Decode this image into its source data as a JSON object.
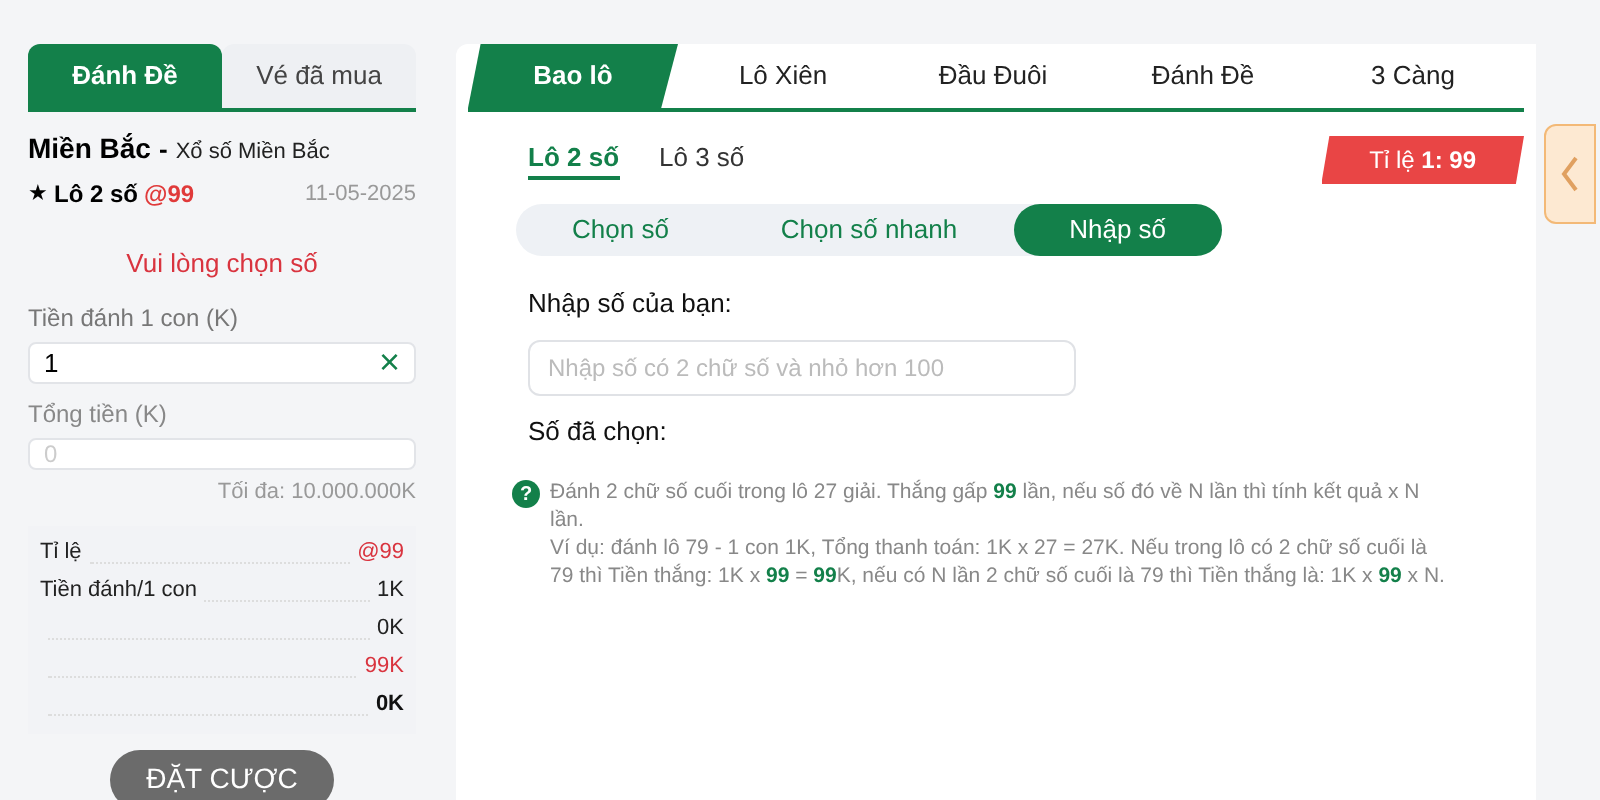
{
  "left_tabs": [
    {
      "label": "Đánh Đề",
      "selected": true
    },
    {
      "label": "Vé đã mua",
      "selected": false
    }
  ],
  "region": {
    "title": "Miền Bắc",
    "separator": "-",
    "subtitle": "Xổ số Miền Bắc"
  },
  "bet_type": {
    "star": "★",
    "name": "Lô 2 số",
    "odds": "@99",
    "date": "11-05-2025"
  },
  "warning": "Vui lòng chọn số",
  "stake_field": {
    "label": "Tiền đánh 1 con (K)",
    "value": "1",
    "clear": "×"
  },
  "total_field": {
    "label": "Tổng tiền (K)",
    "placeholder": "0",
    "max_note": "Tối đa: 10.000.000K"
  },
  "summary": [
    {
      "label": "Tỉ lệ",
      "value": "@99",
      "kind": "red"
    },
    {
      "label": "Tiền đánh/1 con",
      "value": "1K",
      "kind": "plain"
    },
    {
      "value": "0K",
      "kind": "plain"
    },
    {
      "value": "99K",
      "kind": "red"
    },
    {
      "value": "0K",
      "kind": "bold"
    }
  ],
  "submit_button": "ĐẶT CƯỢC",
  "game_tabs": [
    {
      "label": "Bao lô",
      "selected": true
    },
    {
      "label": "Lô Xiên",
      "selected": false
    },
    {
      "label": "Đầu Đuôi",
      "selected": false
    },
    {
      "label": "Đánh Đề",
      "selected": false
    },
    {
      "label": "3 Càng",
      "selected": false
    }
  ],
  "sub_tabs": [
    {
      "label": "Lô 2 số",
      "selected": true
    },
    {
      "label": "Lô 3 số",
      "selected": false
    }
  ],
  "odds_badge": "Tỉ lệ **1: 99**",
  "mode_tabs": [
    {
      "label": "Chọn số",
      "selected": false
    },
    {
      "label": "Chọn số nhanh",
      "selected": false
    },
    {
      "label": "Nhập số",
      "selected": true
    }
  ],
  "number_input": {
    "label": "Nhập số của bạn:",
    "placeholder": "Nhập số có 2 chữ số và nhỏ hơn 100"
  },
  "chosen_label": "Số đã chọn:",
  "help": {
    "icon": "?",
    "lines": [
      "Đánh 2 chữ số cuối trong lô 27 giải. Thắng gấp **99** lần, nếu số đó về N lần thì tính kết quả x N lần.",
      "Ví dụ: đánh lô 79 - 1 con 1K, Tổng thanh toán: 1K x 27 = 27K. Nếu trong lô có 2 chữ số cuối là 79 thì Tiền thắng: 1K x **99** = **99**K, nếu có N lần 2 chữ số cuối là 79 thì Tiền thắng là: 1K x **99** x N."
    ]
  }
}
